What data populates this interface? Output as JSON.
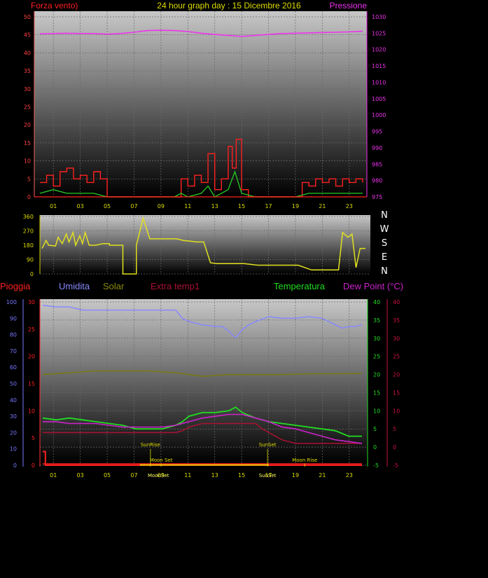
{
  "title": "24 hour graph day : 15 Dicembre 2016",
  "colors": {
    "wind": "#ff2020",
    "gust": "#ffffff",
    "wind_avg": "#22cc22",
    "pressure": "#ee33ee",
    "direction": "#e0e020",
    "humidity": "#8888ff",
    "solar": "#7a7a10",
    "extra_temp": "#aa1133",
    "temperature": "#22dd22",
    "dewpoint": "#cc22cc",
    "rain": "#ff2020",
    "rain_axis": "#7777ff",
    "text_yellow": "#dddd00"
  },
  "chart_data": [
    {
      "type": "line",
      "name": "wind-pressure",
      "left_label": "Forza vento)",
      "right_label": "Pressione",
      "ylim": [
        0,
        50
      ],
      "y2lim": [
        975,
        1030
      ],
      "yticks": [
        "0",
        "5",
        "10",
        "15",
        "20",
        "25",
        "30",
        "35",
        "40",
        "45",
        "50"
      ],
      "y2ticks": [
        "975",
        "980",
        "985",
        "990",
        "995",
        "1000",
        "1005",
        "1010",
        "1015",
        "1020",
        "1025",
        "1030"
      ],
      "xticks": [
        "01",
        "03",
        "05",
        "07",
        "09",
        "11",
        "13",
        "15",
        "17",
        "19",
        "21",
        "23"
      ],
      "series": [
        {
          "key": "pressure",
          "x": [
            0,
            1,
            2,
            3,
            4,
            5,
            6,
            7,
            8,
            9,
            10,
            11,
            12,
            13,
            14,
            15,
            16,
            17,
            18,
            19,
            20,
            21,
            22,
            23,
            24
          ],
          "values": [
            1024.8,
            1024.9,
            1025.0,
            1024.9,
            1024.9,
            1024.7,
            1024.9,
            1025.3,
            1025.8,
            1025.9,
            1025.8,
            1025.5,
            1025.0,
            1024.6,
            1024.3,
            1024.0,
            1024.3,
            1024.6,
            1024.9,
            1025.0,
            1025.1,
            1025.2,
            1025.3,
            1025.4,
            1025.6
          ]
        },
        {
          "key": "wind",
          "x": [
            0,
            0.5,
            1,
            1.5,
            2,
            2.5,
            3,
            3.5,
            4,
            4.5,
            5,
            6,
            7,
            8,
            9,
            10,
            10.5,
            11,
            11.5,
            12,
            12.5,
            13,
            13.5,
            14,
            14.3,
            14.6,
            15,
            15.5,
            16,
            17,
            18,
            19,
            19.5,
            20,
            20.5,
            21,
            21.5,
            22,
            22.5,
            23,
            23.5,
            24
          ],
          "values": [
            4,
            6,
            3,
            7,
            8,
            5,
            6,
            4,
            7,
            5,
            0,
            0,
            0,
            0,
            0,
            0,
            5,
            3,
            6,
            4,
            12,
            2,
            5,
            14,
            8,
            16,
            2,
            0,
            0,
            0,
            0,
            0,
            4,
            3,
            5,
            4,
            5,
            3,
            5,
            4,
            5,
            4
          ]
        },
        {
          "key": "wind_avg",
          "x": [
            0,
            1,
            2,
            3,
            4,
            5,
            6,
            7,
            8,
            9,
            10,
            10.5,
            11,
            12,
            12.5,
            13,
            13.5,
            14,
            14.5,
            15,
            16,
            17,
            18,
            19,
            20,
            21,
            22,
            23,
            24
          ],
          "values": [
            1,
            2,
            1,
            1,
            1,
            0,
            0,
            0,
            0,
            0,
            0,
            1,
            0,
            1,
            3,
            0,
            1,
            2,
            7,
            1,
            0,
            0,
            0,
            0,
            1,
            1,
            1,
            1,
            1
          ]
        }
      ]
    },
    {
      "type": "line",
      "name": "wind-direction",
      "ylim": [
        0,
        360
      ],
      "yticks": [
        "0",
        "90",
        "180",
        "270",
        "360"
      ],
      "compass": [
        "N",
        "W",
        "S",
        "E",
        "N"
      ],
      "series": [
        {
          "key": "direction",
          "x": [
            0,
            0.3,
            0.5,
            1,
            1.2,
            1.5,
            1.8,
            2,
            2.3,
            2.5,
            2.8,
            3,
            3.2,
            3.5,
            4,
            4.5,
            5,
            5,
            6,
            6,
            7,
            7,
            7.5,
            8,
            9,
            10,
            10.5,
            11,
            11.5,
            12,
            12.5,
            13,
            14,
            15,
            16,
            17,
            18,
            19,
            20,
            21,
            22,
            22.3,
            22.7,
            23,
            23.3,
            23.6,
            24
          ],
          "values": [
            160,
            210,
            180,
            175,
            230,
            190,
            250,
            200,
            260,
            180,
            240,
            190,
            260,
            180,
            180,
            190,
            190,
            180,
            180,
            0,
            0,
            180,
            350,
            220,
            220,
            220,
            210,
            205,
            200,
            200,
            70,
            65,
            65,
            65,
            55,
            55,
            55,
            55,
            25,
            25,
            25,
            260,
            230,
            250,
            40,
            160,
            160
          ]
        }
      ]
    },
    {
      "type": "line",
      "name": "temperature-humidity",
      "legend": [
        "Pioggia",
        "Umidita",
        "Solar",
        "Extra temp1",
        "Temperatura",
        "Dew Point (°C)"
      ],
      "rain_ticks": [
        "0",
        "5",
        "10",
        "15",
        "20",
        "25",
        "30"
      ],
      "hum_ticks": [
        "0",
        "10",
        "20",
        "30",
        "40",
        "50",
        "60",
        "70",
        "80",
        "90",
        "100"
      ],
      "temp_ticks": [
        "-5",
        "0",
        "5",
        "10",
        "15",
        "20",
        "25",
        "30",
        "35",
        "40"
      ],
      "dew_ticks": [
        "0",
        "5",
        "10",
        "15",
        "20",
        "25",
        "30",
        "35",
        "40"
      ],
      "xticks": [
        "01",
        "03",
        "05",
        "07",
        "09",
        "11",
        "13",
        "15",
        "17",
        "19",
        "21",
        "23"
      ],
      "annotations": [
        "SunRise",
        "SunSet",
        "Moon Set",
        "Moon Rise",
        "MoonSet",
        "SunSet"
      ],
      "series": [
        {
          "key": "humidity",
          "x": [
            0,
            1,
            2,
            3,
            4,
            5,
            6,
            7,
            8,
            9,
            10,
            10.5,
            11,
            12,
            13,
            13.5,
            14,
            14.5,
            15,
            15.5,
            16,
            17,
            18,
            19,
            20,
            21,
            21.5,
            22,
            22.5,
            23,
            23.5,
            24
          ],
          "values": [
            98,
            97,
            97,
            95,
            95,
            95,
            95,
            95,
            95,
            95,
            95,
            90,
            88,
            86,
            85,
            85,
            82,
            78,
            83,
            86,
            88,
            91,
            90,
            90,
            91,
            90,
            88,
            86,
            84,
            85,
            85,
            86
          ]
        },
        {
          "key": "solar",
          "x": [
            0,
            2,
            4,
            6,
            8,
            10,
            12,
            14,
            16,
            18,
            20,
            22,
            24
          ],
          "values": [
            20,
            20.5,
            21,
            21,
            21,
            20.5,
            19.5,
            20,
            20,
            20,
            20.2,
            20.2,
            20.3
          ]
        },
        {
          "key": "temperature",
          "x": [
            0,
            1,
            2,
            3,
            4,
            5,
            6,
            7,
            8,
            9,
            9.5,
            10,
            10.5,
            11,
            12,
            13,
            14,
            14.5,
            15,
            16,
            17,
            18,
            19,
            20,
            21,
            22,
            23,
            24
          ],
          "values": [
            8,
            7.5,
            8,
            7.5,
            7,
            6.5,
            6,
            5,
            5,
            5,
            5.5,
            6,
            7,
            8.5,
            9.5,
            9.5,
            10,
            11,
            9.5,
            8,
            7,
            6.5,
            6,
            5.5,
            5,
            4.5,
            3,
            3
          ]
        },
        {
          "key": "extra_temp",
          "x": [
            0,
            2,
            4,
            6,
            8,
            9,
            10,
            10.5,
            11,
            12,
            13,
            14,
            15,
            16,
            16.5,
            17,
            18,
            19,
            20,
            21,
            22,
            23,
            24
          ],
          "values": [
            4,
            4,
            4,
            4,
            4,
            4,
            4,
            4.5,
            5.5,
            6.5,
            6.5,
            6.5,
            6.5,
            6.5,
            5,
            4,
            2,
            1,
            1,
            1,
            1,
            1,
            1
          ]
        },
        {
          "key": "dewpoint",
          "x": [
            0,
            1,
            2,
            3,
            4,
            5,
            6,
            7,
            8,
            9,
            10,
            11,
            12,
            13,
            14,
            15,
            16,
            17,
            18,
            19,
            20,
            21,
            22,
            23,
            24
          ],
          "values": [
            7,
            7,
            6.5,
            6.5,
            6.5,
            6,
            5.5,
            5.5,
            5.5,
            5.5,
            6,
            7,
            8,
            8.5,
            9,
            9,
            8,
            7,
            5.5,
            5,
            4,
            3,
            2,
            1.5,
            1
          ]
        },
        {
          "key": "rain",
          "x": [
            0,
            0.1,
            0.2,
            0.3,
            24
          ],
          "values": [
            2.5,
            2.5,
            0,
            0,
            0
          ]
        }
      ]
    }
  ]
}
